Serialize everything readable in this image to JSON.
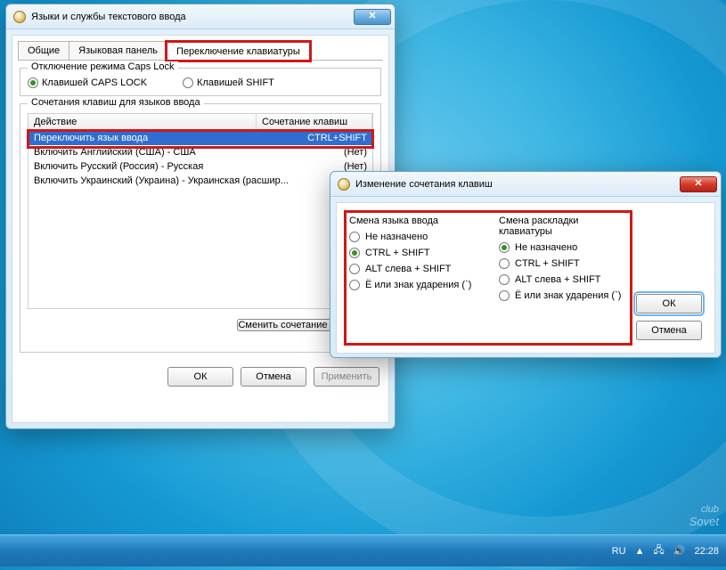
{
  "desktop": {
    "watermark_top": "club",
    "watermark_bottom": "Sovet"
  },
  "taskbar": {
    "lang": "RU",
    "time": "22:28"
  },
  "main": {
    "title": "Языки и службы текстового ввода",
    "tabs": [
      "Общие",
      "Языковая панель",
      "Переключение клавиатуры"
    ],
    "active_tab": 2,
    "caps_group": {
      "legend": "Отключение режима Caps Lock",
      "opt1": "Клавишей CAPS LOCK",
      "opt2": "Клавишей SHIFT",
      "selected": 0
    },
    "hotkeys_group": {
      "legend": "Сочетания клавиш для языков ввода",
      "col_action": "Действие",
      "col_combo": "Сочетание клавиш",
      "rows": [
        {
          "action": "Переключить язык ввода",
          "combo": "CTRL+SHIFT",
          "selected": true
        },
        {
          "action": "Включить Английский (США) - США",
          "combo": "(Нет)"
        },
        {
          "action": "Включить Русский (Россия) - Русская",
          "combo": "(Нет)"
        },
        {
          "action": "Включить Украинский (Украина) - Украинская (расшир...",
          "combo": ""
        }
      ],
      "change_btn": "Сменить сочетание клавиш..."
    },
    "buttons": {
      "ok": "ОК",
      "cancel": "Отмена",
      "apply": "Применить"
    }
  },
  "dialog": {
    "title": "Изменение сочетания клавиш",
    "left": {
      "label": "Смена языка ввода",
      "options": [
        "Не назначено",
        "CTRL + SHIFT",
        "ALT слева + SHIFT",
        "Ё или знак ударения (`)"
      ],
      "selected": 1
    },
    "right": {
      "label": "Смена раскладки клавиатуры",
      "options": [
        "Не назначено",
        "CTRL + SHIFT",
        "ALT слева + SHIFT",
        "Ё или знак ударения (`)"
      ],
      "selected": 0
    },
    "ok": "ОК",
    "cancel": "Отмена"
  }
}
